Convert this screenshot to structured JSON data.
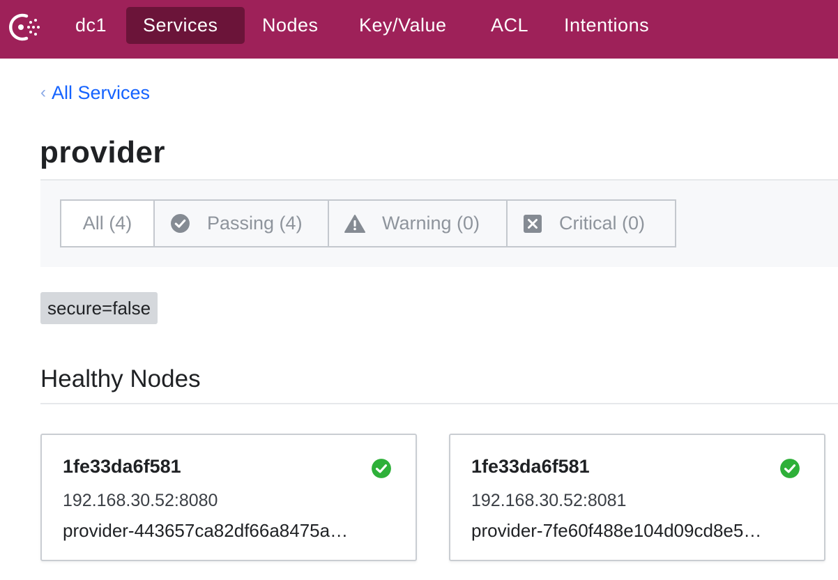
{
  "nav": {
    "logo_icon": "consul-logo-icon",
    "datacenter": "dc1",
    "items": [
      {
        "label": "Services",
        "active": true
      },
      {
        "label": "Nodes",
        "active": false
      },
      {
        "label": "Key/Value",
        "active": false
      },
      {
        "label": "ACL",
        "active": false
      },
      {
        "label": "Intentions",
        "active": false
      }
    ],
    "bg_color": "#9e2159",
    "active_color": "#6b1439"
  },
  "breadcrumb": {
    "label": "All Services",
    "icon": "chevron-left-icon"
  },
  "page": {
    "title": "provider"
  },
  "filters": [
    {
      "label": "All (4)",
      "icon": "",
      "selected": true
    },
    {
      "label": "Passing (4)",
      "icon": "check-circle-icon",
      "selected": false
    },
    {
      "label": "Warning (0)",
      "icon": "warning-triangle-icon",
      "selected": false
    },
    {
      "label": "Critical (0)",
      "icon": "critical-x-icon",
      "selected": false
    }
  ],
  "tags": [
    "secure=false"
  ],
  "healthy_nodes": {
    "title": "Healthy Nodes",
    "nodes": [
      {
        "name": "1fe33da6f581",
        "address": "192.168.30.52:8080",
        "service_id": "provider-443657ca82df66a8475a…",
        "status_icon": "passing-check-icon",
        "status_color": "#2eb039"
      },
      {
        "name": "1fe33da6f581",
        "address": "192.168.30.52:8081",
        "service_id": "provider-7fe60f488e104d09cd8e5…",
        "status_icon": "passing-check-icon",
        "status_color": "#2eb039"
      }
    ]
  }
}
